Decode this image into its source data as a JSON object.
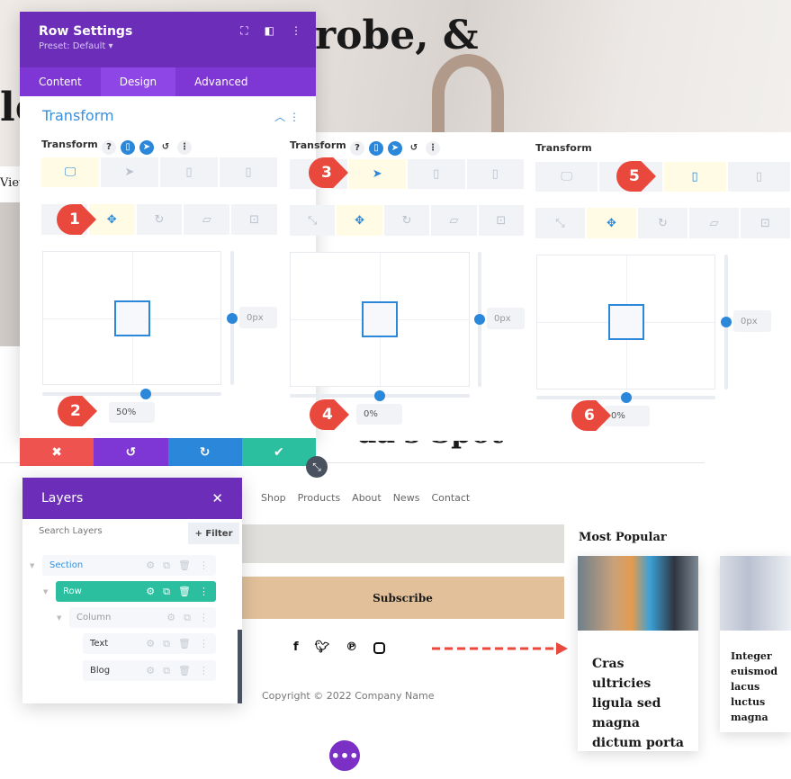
{
  "page": {
    "title_fragment": "robe, &",
    "title_fragment2": "le",
    "view_fragment": "View",
    "spot_title": "da's Spot",
    "nav": [
      "Shop",
      "Products",
      "About",
      "News",
      "Contact"
    ],
    "subscribe": "Subscribe",
    "social": [
      "facebook-icon",
      "twitter-icon",
      "pinterest-icon",
      "instagram-icon"
    ],
    "copyright": "Copyright © 2022 Company Name",
    "most_popular": "Most Popular",
    "posts": [
      {
        "title": "Cras ultricies ligula sed magna dictum porta"
      },
      {
        "title": "Integer euismod lacus luctus magna"
      }
    ]
  },
  "row_settings": {
    "title": "Row Settings",
    "preset": "Preset: Default ▾",
    "tabs": [
      "Content",
      "Design",
      "Advanced"
    ],
    "active_tab": "Design",
    "section_title": "Transform",
    "buttons": {
      "cancel": "✖",
      "undo": "↺",
      "redo": "↻",
      "save": "✔"
    }
  },
  "transform_panels": [
    {
      "label": "Transform",
      "active_device": 0,
      "active_type": 1,
      "x_value": "50%",
      "y_value": "0px",
      "x_fraction": 0.58,
      "marker_device": null,
      "show_controls": true
    },
    {
      "label": "Transform",
      "active_device": 1,
      "active_type": 1,
      "x_value": "0%",
      "y_value": "0px",
      "x_fraction": 0.5,
      "show_controls": true
    },
    {
      "label": "Transform",
      "active_device": 2,
      "active_type": 1,
      "x_value": "0%",
      "y_value": "0px",
      "x_fraction": 0.5,
      "show_controls": false
    }
  ],
  "markers": [
    "1",
    "2",
    "3",
    "4",
    "5",
    "6"
  ],
  "layers": {
    "title": "Layers",
    "search_placeholder": "Search Layers",
    "filter": "+ Filter",
    "items": [
      {
        "label": "Section",
        "level": 0
      },
      {
        "label": "Row",
        "level": 1
      },
      {
        "label": "Column",
        "level": 2
      },
      {
        "label": "Text",
        "level": 3
      },
      {
        "label": "Blog",
        "level": 3
      }
    ]
  },
  "colors": {
    "purple": "#6c2eb9",
    "accent_blue": "#2b87da",
    "green": "#2bbf9f",
    "red": "#ef5350",
    "marker": "#e9483d",
    "tan": "#e2c09a"
  }
}
